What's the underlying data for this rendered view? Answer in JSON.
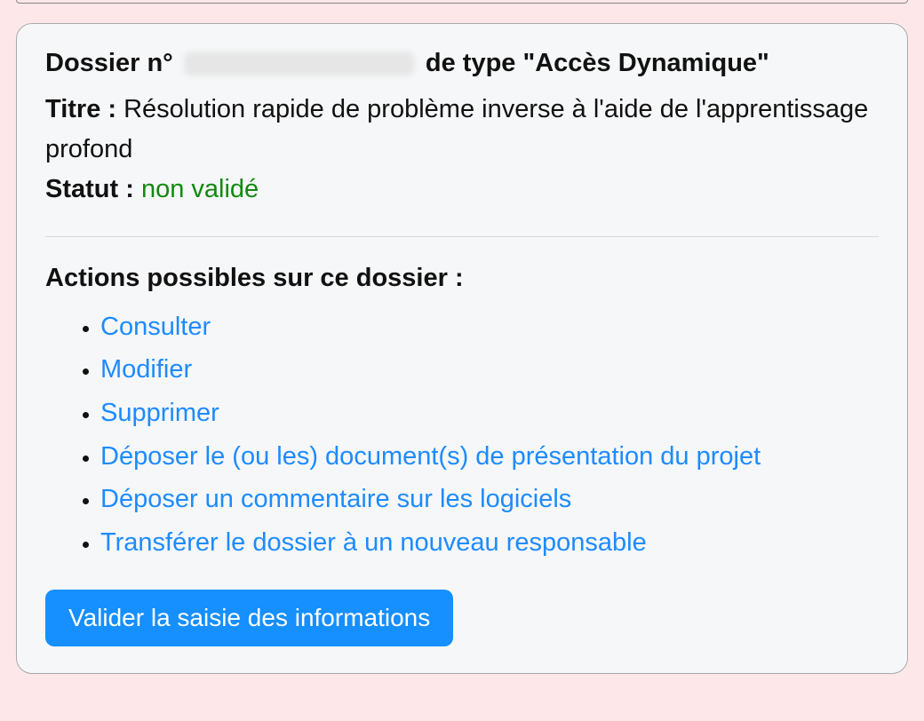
{
  "dossier": {
    "label_prefix": "Dossier n°",
    "label_type_prefix": "de type",
    "type": "\"Accès Dynamique\"",
    "title_label": "Titre :",
    "title_value": "Résolution rapide de problème inverse à l'aide de l'apprentissage profond",
    "status_label": "Statut :",
    "status_value": "non validé"
  },
  "actions": {
    "heading": "Actions possibles sur ce dossier :",
    "items": [
      "Consulter",
      "Modifier",
      "Supprimer",
      "Déposer le (ou les) document(s) de présentation du projet",
      "Déposer un commentaire sur les logiciels",
      "Transférer le dossier à un nouveau responsable"
    ],
    "validate_button": "Valider la saisie des informations"
  }
}
